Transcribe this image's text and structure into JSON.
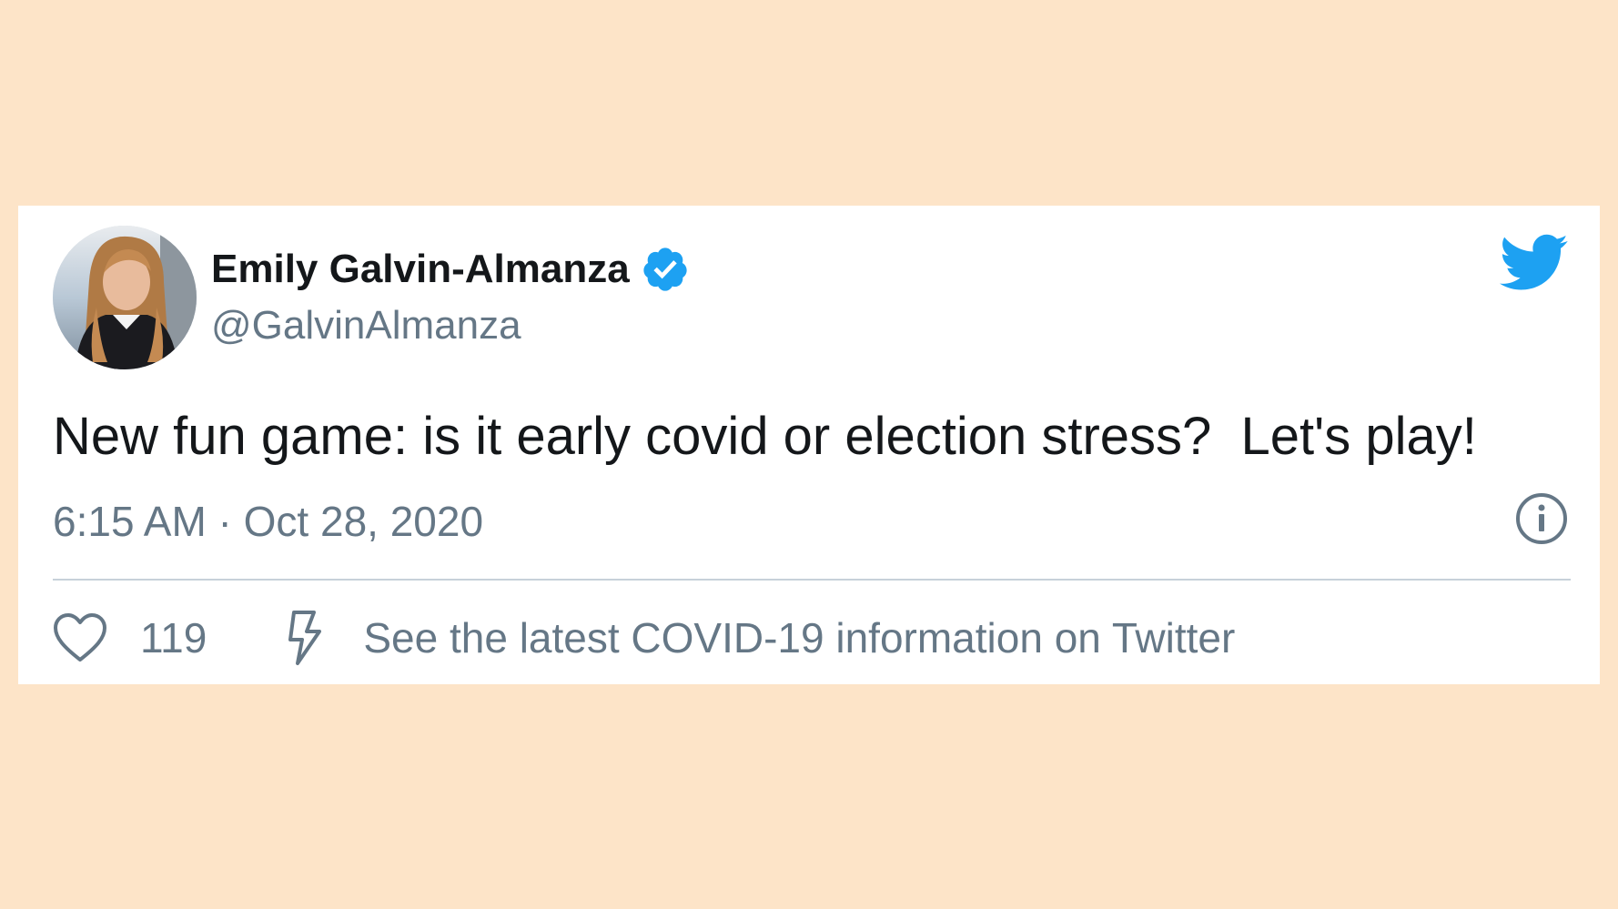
{
  "tweet": {
    "author": {
      "display_name": "Emily Galvin-Almanza",
      "handle": "@GalvinAlmanza",
      "verified": true
    },
    "text": "New fun game: is it early covid or election stress?  Let's play!",
    "timestamp": "6:15 AM · Oct 28, 2020",
    "likes": "119",
    "covid_link_text": "See the latest COVID-19 information on Twitter"
  },
  "icons": {
    "avatar": "profile-photo",
    "verified": "verified-badge-icon",
    "brand": "twitter-bird-icon",
    "info": "info-icon",
    "like": "heart-icon",
    "covid": "lightning-bolt-icon"
  },
  "colors": {
    "background": "#fde4c8",
    "card": "#ffffff",
    "text_primary": "#14171a",
    "text_secondary": "#657786",
    "twitter_blue": "#1da1f2",
    "divider": "#c7d1da"
  }
}
